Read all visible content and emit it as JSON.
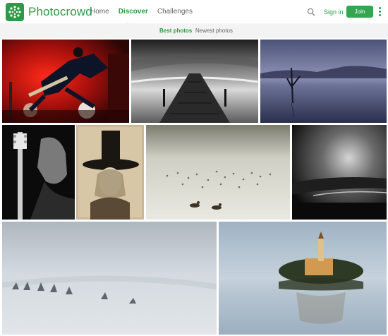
{
  "app": {
    "brand": "Photocrowd"
  },
  "nav": {
    "home": "Home",
    "discover": "Discover",
    "challenges": "Challenges"
  },
  "actions": {
    "sign_in": "Sign in",
    "join": "Join"
  },
  "tabs": {
    "best": "Best photos",
    "newest": "Newest photos"
  },
  "icons": {
    "logo": "photocrowd-logo-icon",
    "search": "search-icon",
    "more": "more-vertical-icon"
  },
  "colors": {
    "brand_green": "#2c9a46",
    "join_button": "#2fa84f",
    "subnav_bg": "#f3f3f3"
  },
  "photos": [
    {
      "subject": "guitarist jumping on red-lit stage"
    },
    {
      "subject": "black and white pier with long exposure sky"
    },
    {
      "subject": "blue dusk lake with dead tree"
    },
    {
      "subject": "black and white portrait of man with bass guitar"
    },
    {
      "subject": "sepia portrait of girl in tall top hat"
    },
    {
      "subject": "misty water with flock of birds and ducks"
    },
    {
      "subject": "dark black and white seascape"
    },
    {
      "subject": "snow field with fence posts"
    },
    {
      "subject": "Lake Bled island church in fog"
    }
  ]
}
